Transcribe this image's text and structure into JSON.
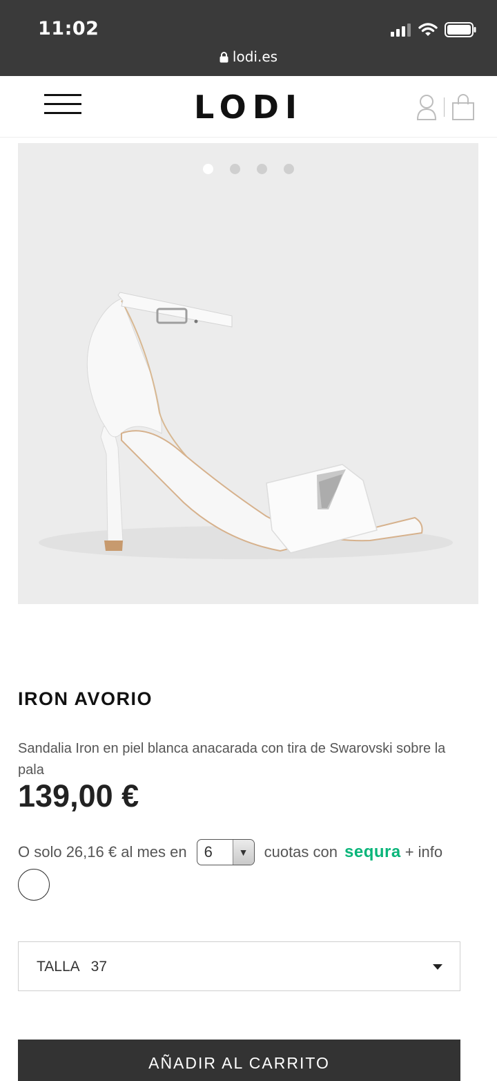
{
  "status_bar": {
    "time": "11:02",
    "url": "lodi.es"
  },
  "header": {
    "logo": "LODI"
  },
  "gallery": {
    "image_count": 4,
    "active_index": 0
  },
  "product": {
    "name": "IRON AVORIO",
    "description": "Sandalia Iron en piel blanca anacarada con tira de Swarovski sobre la pala",
    "price": "139,00 €"
  },
  "financing": {
    "prefix": "O solo 26,16 € al mes en",
    "installments": "6",
    "suffix": "cuotas con",
    "provider": "sequra",
    "more": "+ info"
  },
  "size_select": {
    "label": "TALLA",
    "value": "37"
  },
  "cart_button": {
    "label": "AÑADIR AL CARRITO"
  },
  "colors": {
    "status_bar": "#3a3a3a",
    "sequra_green": "#0ab57a",
    "button_bg": "#333333"
  }
}
